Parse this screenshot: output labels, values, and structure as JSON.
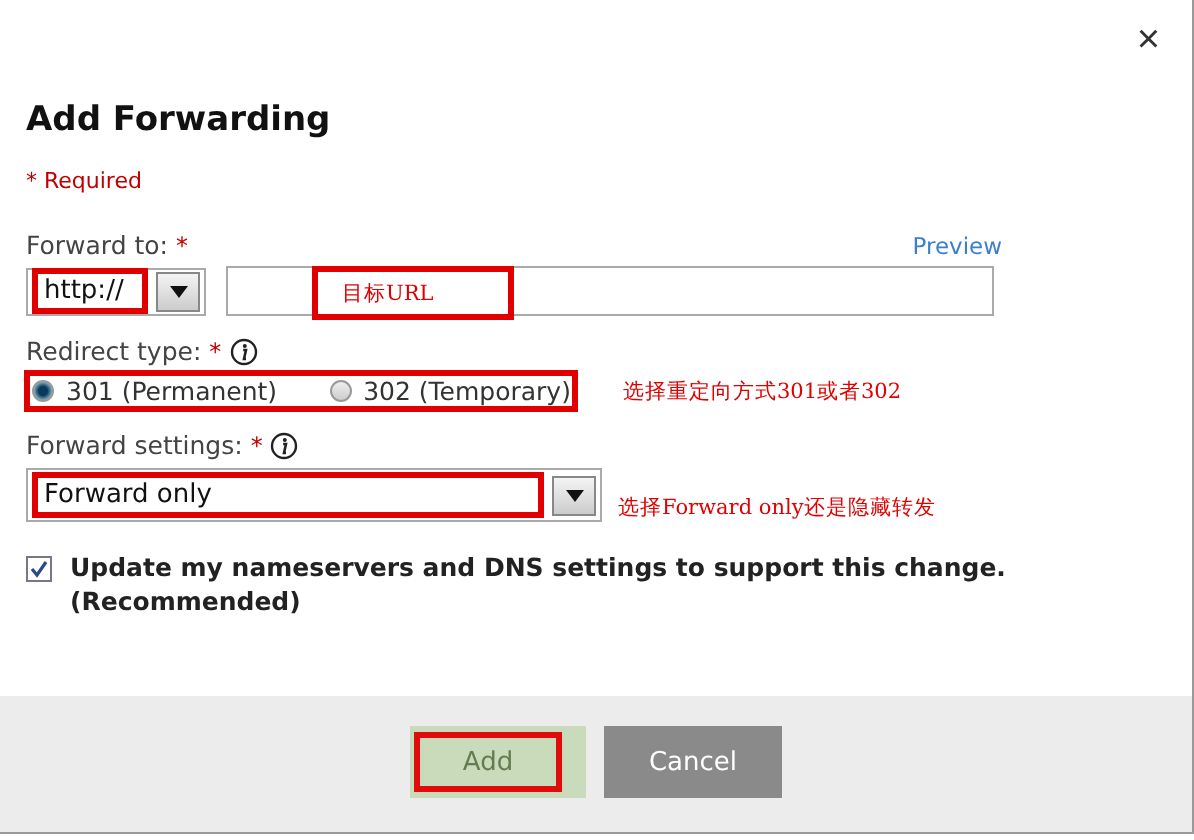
{
  "dialog": {
    "title": "Add Forwarding",
    "close": "×",
    "required_note": "* Required"
  },
  "forward_to": {
    "label": "Forward to:",
    "required_mark": "*",
    "preview_link": "Preview",
    "protocol": {
      "value": "http://",
      "annotated": true
    },
    "url": {
      "annotation": "目标URL"
    }
  },
  "redirect_type": {
    "label": "Redirect type:",
    "required_mark": "*",
    "options": [
      {
        "label": "301 (Permanent)",
        "selected": true
      },
      {
        "label": "302 (Temporary)",
        "selected": false
      }
    ],
    "annotated": true,
    "annotation": "选择重定向方式301或者302"
  },
  "forward_settings": {
    "label": "Forward settings:",
    "required_mark": "*",
    "value": "Forward only",
    "annotated": true,
    "annotation": "选择Forward only还是隐藏转发"
  },
  "update_dns": {
    "label": "Update my nameservers and DNS settings to support this change. (Recommended)",
    "checked": true
  },
  "buttons": [
    {
      "label": "Add",
      "kind": "primary",
      "disabled": true,
      "annotated": true
    },
    {
      "label": "Cancel",
      "kind": "secondary",
      "disabled": false,
      "annotated": false
    }
  ]
}
